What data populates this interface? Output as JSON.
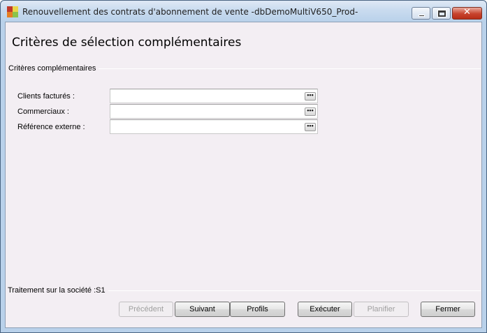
{
  "window": {
    "title": "Renouvellement des contrats d'abonnement de vente -dbDemoMultiV650_Prod-",
    "close_glyph": "✕"
  },
  "page": {
    "heading": "Critères de sélection complémentaires"
  },
  "criteria": {
    "group_label": "Critères complémentaires",
    "fields": [
      {
        "label": "Clients facturés :",
        "value": "",
        "button": "•••"
      },
      {
        "label": "Commerciaux :",
        "value": "",
        "button": "•••"
      },
      {
        "label": "Référence externe :",
        "value": "",
        "button": "•••"
      }
    ]
  },
  "footer": {
    "company_label": "Traitement sur la société :S1",
    "buttons": [
      {
        "label": "Précédent",
        "enabled": false
      },
      {
        "label": "Suivant",
        "enabled": true
      },
      {
        "label": "Profils",
        "enabled": true
      },
      {
        "label": "Exécuter",
        "enabled": true
      },
      {
        "label": "Planifier",
        "enabled": false
      },
      {
        "label": "Fermer",
        "enabled": true
      }
    ]
  },
  "colors": {
    "client_background": "#f3eef3",
    "frame": "#b9d1ea",
    "close_button": "#c7432d"
  }
}
